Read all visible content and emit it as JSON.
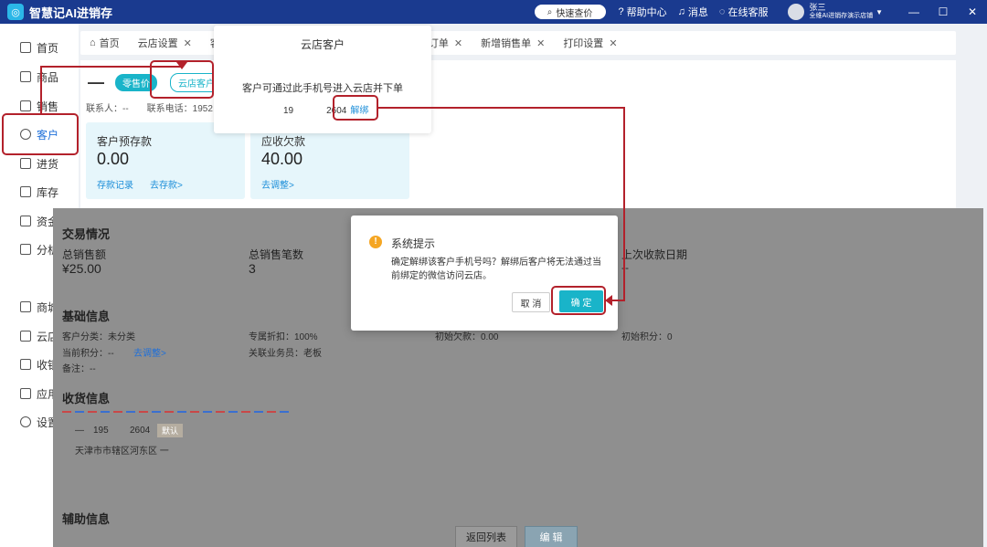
{
  "app": {
    "title": "智慧记AI进销存",
    "logo_glyph": "◎"
  },
  "topbar": {
    "search_label": "快速查价",
    "help_label": "帮助中心",
    "message_label": "消息",
    "support_label": "在线客服",
    "user_name": "张三",
    "store_name": "全维AI进销存演示店铺",
    "minimize": "—",
    "maximize": "☐",
    "close": "✕"
  },
  "sidebar": {
    "items": [
      {
        "label": "首页"
      },
      {
        "label": "商品"
      },
      {
        "label": "销售"
      },
      {
        "label": "客户"
      },
      {
        "label": "进货"
      },
      {
        "label": "库存"
      },
      {
        "label": "资金"
      },
      {
        "label": "分析"
      },
      {
        "label": "商城"
      },
      {
        "label": "云店"
      },
      {
        "label": "收银"
      },
      {
        "label": "应用"
      },
      {
        "label": "设置"
      }
    ]
  },
  "tabs": [
    {
      "label": "首页"
    },
    {
      "label": "云店设置"
    },
    {
      "label": "客"
    },
    {
      "label": "订单"
    },
    {
      "label": "新增销售单"
    },
    {
      "label": "打印设置"
    }
  ],
  "customer": {
    "name": "—",
    "price_tag": "零售价",
    "cloud_tag": "云店客户",
    "contact_label": "联系人：--",
    "phone_label": "联系电话：1952"
  },
  "cards": [
    {
      "label": "客户预存款",
      "value": "0.00",
      "link1": "存款记录",
      "link2": "去存款>"
    },
    {
      "label": "应收欠款",
      "value": "40.00",
      "link1": "去调整>"
    }
  ],
  "popover": {
    "title": "云店客户",
    "desc": "客户可通过此手机号进入云店并下单",
    "phone_start": "19",
    "phone_end": "2604",
    "unbind": "解绑"
  },
  "trade": {
    "title": "交易情况",
    "total_sales_label": "总销售额",
    "total_sales_value": "¥25.00",
    "total_count_label": "总销售笔数",
    "total_count_value": "3",
    "last_receipt_label": "上次收款日期",
    "last_receipt_value": "--"
  },
  "basic": {
    "title": "基础信息",
    "category": "客户分类：未分类",
    "discount": "专属折扣：100%",
    "initial_debt": "初始欠款：0.00",
    "initial_points": "初始积分：0",
    "current_points": "当前积分：--",
    "adjust": "去调整>",
    "salesperson": "关联业务员：老板",
    "remark": "备注：--"
  },
  "shipping": {
    "title": "收货信息",
    "name": "—",
    "phone_start": "195",
    "phone_end": "2604",
    "default_tag": "默认",
    "address": "天津市市辖区河东区 一"
  },
  "aux": {
    "title": "辅助信息"
  },
  "footer": {
    "back": "返回列表",
    "edit": "编 辑"
  },
  "dialog": {
    "icon": "!",
    "title": "系统提示",
    "message": "确定解绑该客户手机号吗？解绑后客户将无法通过当前绑定的微信访问云店。",
    "cancel": "取 消",
    "ok": "确 定"
  }
}
